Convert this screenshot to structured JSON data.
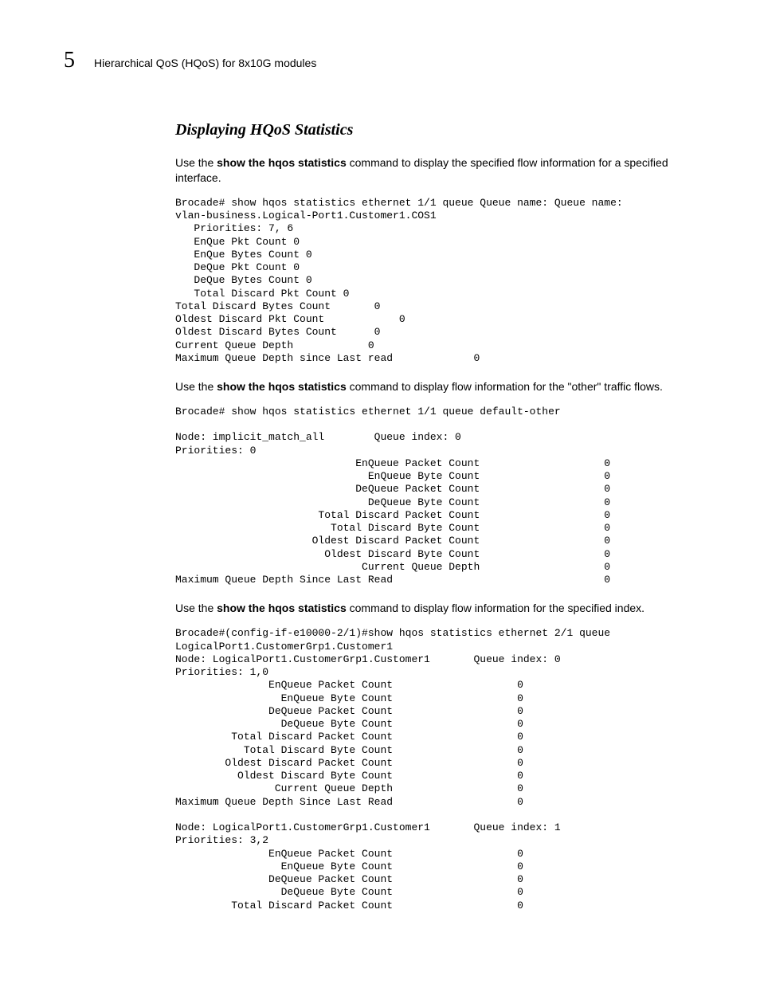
{
  "header": {
    "chapter_number": "5",
    "chapter_title": "Hierarchical QoS (HQoS) for 8x10G modules"
  },
  "section": {
    "title": "Displaying HQoS Statistics"
  },
  "p1": {
    "pre": "Use the ",
    "cmd": "show the hqos statistics",
    "post": " command to display the specified flow information for a specified interface."
  },
  "code1": "Brocade# show hqos statistics ethernet 1/1 queue Queue name: Queue name: \nvlan-business.Logical-Port1.Customer1.COS1\n   Priorities: 7, 6\n   EnQue Pkt Count 0\n   EnQue Bytes Count 0\n   DeQue Pkt Count 0\n   DeQue Bytes Count 0\n   Total Discard Pkt Count 0\nTotal Discard Bytes Count       0\nOldest Discard Pkt Count            0\nOldest Discard Bytes Count      0\nCurrent Queue Depth            0\nMaximum Queue Depth since Last read             0",
  "p2": {
    "pre": "Use the ",
    "cmd": "show the hqos statistics",
    "post": " command to display flow information for the \"other\" traffic flows."
  },
  "code2": "Brocade# show hqos statistics ethernet 1/1 queue default-other\n\nNode: implicit_match_all        Queue index: 0\nPriorities: 0\n                             EnQueue Packet Count                    0\n                               EnQueue Byte Count                    0\n                             DeQueue Packet Count                    0\n                               DeQueue Byte Count                    0\n                       Total Discard Packet Count                    0\n                         Total Discard Byte Count                    0\n                      Oldest Discard Packet Count                    0\n                        Oldest Discard Byte Count                    0\n                              Current Queue Depth                    0\nMaximum Queue Depth Since Last Read                                  0",
  "p3": {
    "pre": "Use the ",
    "cmd": "show the hqos statistics",
    "post": " command to display flow information for the specified index."
  },
  "code3": "Brocade#(config-if-e10000-2/1)#show hqos statistics ethernet 2/1 queue \nLogicalPort1.CustomerGrp1.Customer1\nNode: LogicalPort1.CustomerGrp1.Customer1       Queue index: 0\nPriorities: 1,0\n               EnQueue Packet Count                    0\n                 EnQueue Byte Count                    0\n               DeQueue Packet Count                    0\n                 DeQueue Byte Count                    0\n         Total Discard Packet Count                    0\n           Total Discard Byte Count                    0\n        Oldest Discard Packet Count                    0\n          Oldest Discard Byte Count                    0\n                Current Queue Depth                    0\nMaximum Queue Depth Since Last Read                    0\n\nNode: LogicalPort1.CustomerGrp1.Customer1       Queue index: 1\nPriorities: 3,2\n               EnQueue Packet Count                    0\n                 EnQueue Byte Count                    0\n               DeQueue Packet Count                    0\n                 DeQueue Byte Count                    0\n         Total Discard Packet Count                    0"
}
